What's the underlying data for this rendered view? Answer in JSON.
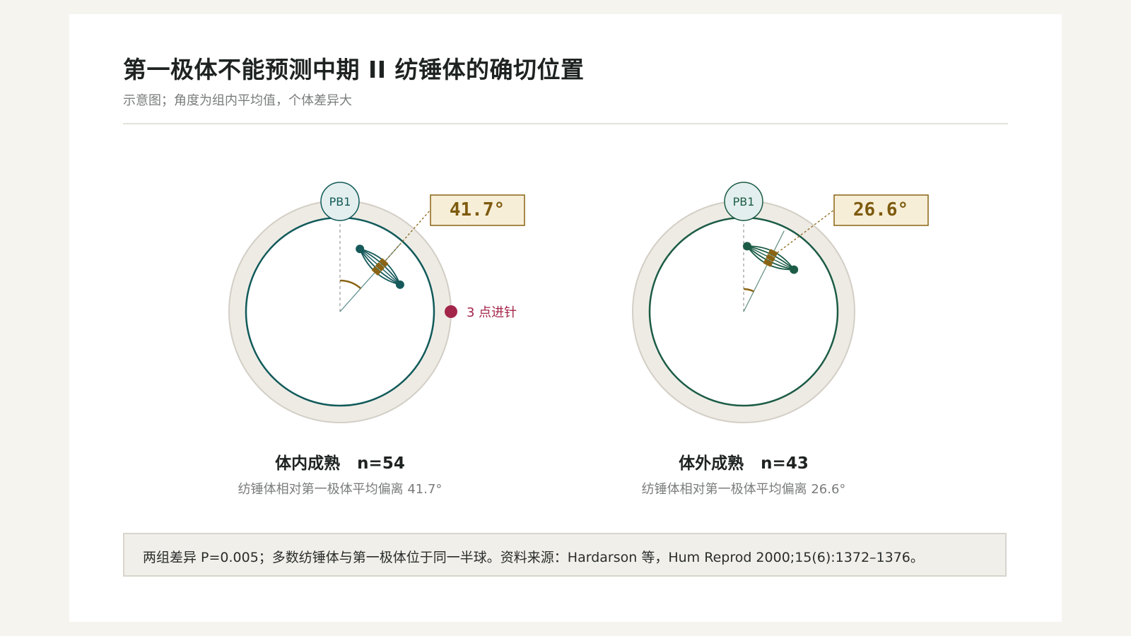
{
  "header": {
    "title": "第一极体不能预测中期 II 纺锤体的确切位置",
    "subtitle": "示意图；角度为组内平均值，个体差异大"
  },
  "panels": [
    {
      "pb_label": "PB1",
      "angle_deg": 41.7,
      "angle_label": "41.7°",
      "clock_label": "3 点进针",
      "group_name": "体内成熟",
      "n_label": "n=54",
      "caption": "纺锤体相对第一极体平均偏离 41.7°",
      "colors": {
        "oolemma": "#115a5a",
        "spindle": "#16595a",
        "chromosome": "#8a6414",
        "arc": "#8a6414",
        "marker": "#a3264a"
      }
    },
    {
      "pb_label": "PB1",
      "angle_deg": 26.6,
      "angle_label": "26.6°",
      "group_name": "体外成熟",
      "n_label": "n=43",
      "caption": "纺锤体相对第一极体平均偏离 26.6°",
      "colors": {
        "oolemma": "#1c5c46",
        "spindle": "#1c5c46",
        "chromosome": "#8a6414",
        "arc": "#8a6414"
      }
    }
  ],
  "footnote": "两组差异 P=0.005；多数纺锤体与第一极体位于同一半球。资料来源：Hardarson 等，Hum Reprod 2000;15(6):1372–1376。",
  "colors": {
    "zona": "#eeebe5",
    "zona_edge": "#d3cfc6",
    "angle_box_fill": "#f7eed8",
    "angle_box_stroke": "#8a6414",
    "angle_text": "#7d5a0e",
    "pb_fill": "#e3efee"
  }
}
